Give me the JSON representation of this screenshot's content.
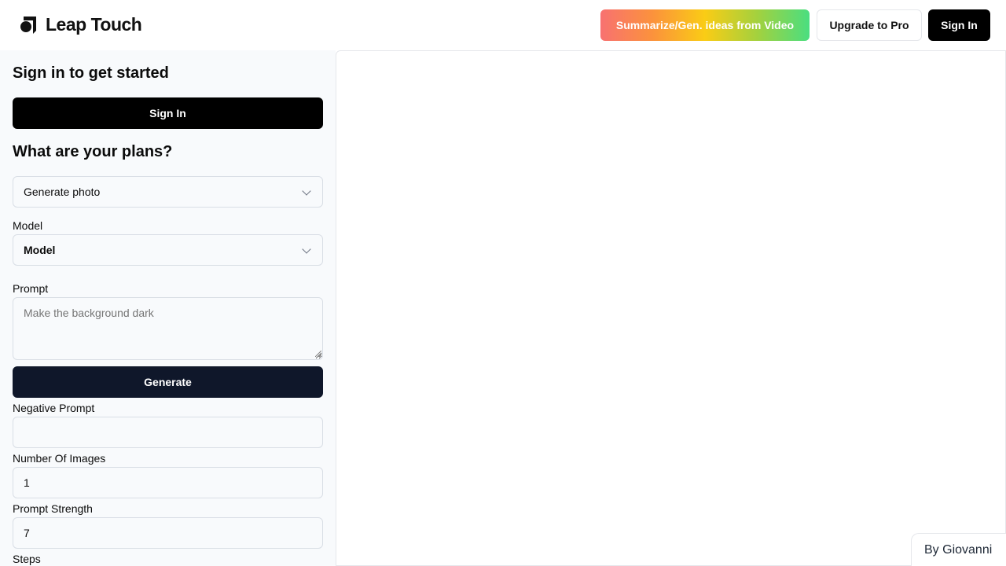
{
  "header": {
    "brand": "Leap Touch",
    "buttons": {
      "summarize": "Summarize/Gen. ideas from Video",
      "upgrade": "Upgrade to Pro",
      "sign_in": "Sign In"
    }
  },
  "sidebar": {
    "signin_heading": "Sign in to get started",
    "signin_button": "Sign In",
    "plans_heading": "What are your plans?",
    "plans_select": {
      "value": "Generate photo"
    },
    "model": {
      "label": "Model",
      "value": "Model"
    },
    "prompt": {
      "label": "Prompt",
      "placeholder": "Make the background dark",
      "value": ""
    },
    "generate_button": "Generate",
    "negative_prompt": {
      "label": "Negative Prompt",
      "value": ""
    },
    "number_of_images": {
      "label": "Number Of Images",
      "value": "1"
    },
    "prompt_strength": {
      "label": "Prompt Strength",
      "value": "7"
    },
    "steps": {
      "label": "Steps"
    }
  },
  "footer": {
    "credit": "By Giovanni"
  },
  "colors": {
    "primary_black": "#000000",
    "generate_bg": "#0f172a",
    "sidebar_bg": "#f8fafc",
    "gradient": [
      "#f87171",
      "#fb923c",
      "#facc15",
      "#a3d13e",
      "#4ade80"
    ]
  }
}
